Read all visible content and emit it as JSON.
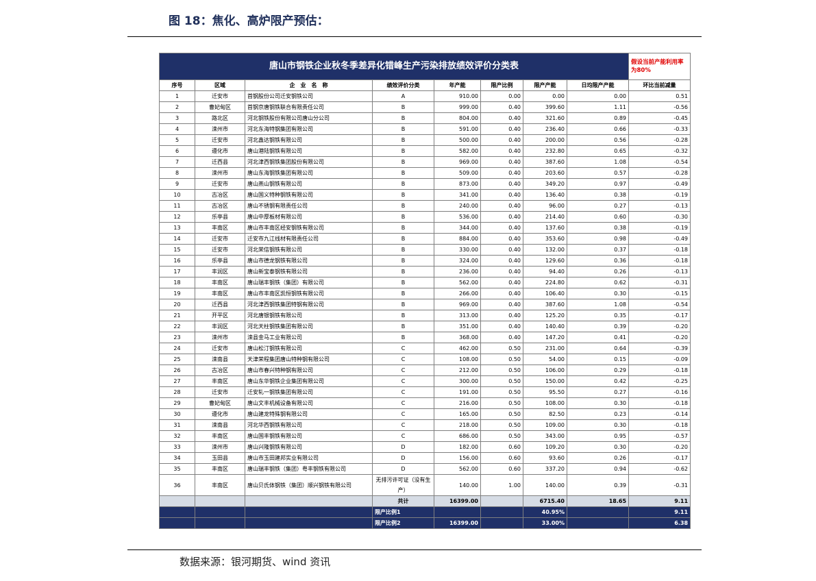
{
  "figure_title": "图 18：焦化、高炉限产预估：",
  "source": "数据来源：银河期货、wind 资讯",
  "table": {
    "title": "唐山市钢铁企业秋冬季差异化错峰生产污染排放绩效评价分类表",
    "note": "假设当前产能利用率为80%",
    "headers": [
      "序号",
      "区域",
      "企　业　名　称",
      "绩效评价分类",
      "年产能",
      "限产比例",
      "限产产能",
      "日均限产产能",
      "环比当前减量"
    ],
    "rows": [
      [
        "1",
        "迁安市",
        "首钢股份公司迁安钢铁公司",
        "A",
        "910.00",
        "0.00",
        "0.00",
        "0.00",
        "0.51"
      ],
      [
        "2",
        "曹妃甸区",
        "首钢京唐钢铁联合有限责任公司",
        "B",
        "999.00",
        "0.40",
        "399.60",
        "1.11",
        "-0.56"
      ],
      [
        "3",
        "路北区",
        "河北钢铁股份有限公司唐山分公司",
        "B",
        "804.00",
        "0.40",
        "321.60",
        "0.89",
        "-0.45"
      ],
      [
        "4",
        "滦州市",
        "河北东海特钢集团有限公司",
        "B",
        "591.00",
        "0.40",
        "236.40",
        "0.66",
        "-0.33"
      ],
      [
        "5",
        "迁安市",
        "河北鑫达钢铁有限公司",
        "B",
        "500.00",
        "0.40",
        "200.00",
        "0.56",
        "-0.28"
      ],
      [
        "6",
        "遵化市",
        "唐山港陆钢铁有限公司",
        "B",
        "582.00",
        "0.40",
        "232.80",
        "0.65",
        "-0.32"
      ],
      [
        "7",
        "迁西县",
        "河北津西钢铁集团股份有限公司",
        "B",
        "969.00",
        "0.40",
        "387.60",
        "1.08",
        "-0.54"
      ],
      [
        "8",
        "滦州市",
        "唐山东海钢铁集团有限公司",
        "B",
        "509.00",
        "0.40",
        "203.60",
        "0.57",
        "-0.28"
      ],
      [
        "9",
        "迁安市",
        "唐山燕山钢铁有限公司",
        "B",
        "873.00",
        "0.40",
        "349.20",
        "0.97",
        "-0.49"
      ],
      [
        "10",
        "古冶区",
        "唐山国义特种钢铁有限公司",
        "B",
        "341.00",
        "0.40",
        "136.40",
        "0.38",
        "-0.19"
      ],
      [
        "11",
        "古冶区",
        "唐山不锈钢有限责任公司",
        "B",
        "240.00",
        "0.40",
        "96.00",
        "0.27",
        "-0.13"
      ],
      [
        "12",
        "乐亭县",
        "唐山中厚板材有限公司",
        "B",
        "536.00",
        "0.40",
        "214.40",
        "0.60",
        "-0.30"
      ],
      [
        "13",
        "丰南区",
        "唐山市丰南区经安钢铁有限公司",
        "B",
        "344.00",
        "0.40",
        "137.60",
        "0.38",
        "-0.19"
      ],
      [
        "14",
        "迁安市",
        "迁安市九江线材有限责任公司",
        "B",
        "884.00",
        "0.40",
        "353.60",
        "0.98",
        "-0.49"
      ],
      [
        "15",
        "迁安市",
        "河北荣信钢铁有限公司",
        "B",
        "330.00",
        "0.40",
        "132.00",
        "0.37",
        "-0.18"
      ],
      [
        "16",
        "乐亭县",
        "唐山市德龙钢铁有限公司",
        "B",
        "324.00",
        "0.40",
        "129.60",
        "0.36",
        "-0.18"
      ],
      [
        "17",
        "丰润区",
        "唐山新宝泰钢铁有限公司",
        "B",
        "236.00",
        "0.40",
        "94.40",
        "0.26",
        "-0.13"
      ],
      [
        "18",
        "丰南区",
        "唐山瑞丰钢铁（集团）有限公司",
        "B",
        "562.00",
        "0.40",
        "224.80",
        "0.62",
        "-0.31"
      ],
      [
        "19",
        "丰南区",
        "唐山市丰南区凯恒钢铁有限公司",
        "B",
        "266.00",
        "0.40",
        "106.40",
        "0.30",
        "-0.15"
      ],
      [
        "20",
        "迁西县",
        "河北津西钢铁集团特钢有限公司",
        "B",
        "969.00",
        "0.40",
        "387.60",
        "1.08",
        "-0.54"
      ],
      [
        "21",
        "开平区",
        "河北唐银钢铁有限公司",
        "B",
        "313.00",
        "0.40",
        "125.20",
        "0.35",
        "-0.17"
      ],
      [
        "22",
        "丰润区",
        "河北天柱钢铁集团有限公司",
        "B",
        "351.00",
        "0.40",
        "140.40",
        "0.39",
        "-0.20"
      ],
      [
        "23",
        "滦州市",
        "滦县金马工业有限公司",
        "B",
        "368.00",
        "0.40",
        "147.20",
        "0.41",
        "-0.20"
      ],
      [
        "24",
        "迁安市",
        "唐山松汀钢铁有限公司",
        "C",
        "462.00",
        "0.50",
        "231.00",
        "0.64",
        "-0.39"
      ],
      [
        "25",
        "滦南县",
        "天津荣程集团唐山特种钢有限公司",
        "C",
        "108.00",
        "0.50",
        "54.00",
        "0.15",
        "-0.09"
      ],
      [
        "26",
        "古冶区",
        "唐山市春兴特种钢有限公司",
        "C",
        "212.00",
        "0.50",
        "106.00",
        "0.29",
        "-0.18"
      ],
      [
        "27",
        "丰南区",
        "唐山东华钢铁企业集团有限公司",
        "C",
        "300.00",
        "0.50",
        "150.00",
        "0.42",
        "-0.25"
      ],
      [
        "28",
        "迁安市",
        "迁安轧一钢铁集团有限公司",
        "C",
        "191.00",
        "0.50",
        "95.50",
        "0.27",
        "-0.16"
      ],
      [
        "29",
        "曹妃甸区",
        "唐山文丰机械设备有限公司",
        "C",
        "216.00",
        "0.50",
        "108.00",
        "0.30",
        "-0.18"
      ],
      [
        "30",
        "遵化市",
        "唐山建龙特殊钢有限公司",
        "C",
        "165.00",
        "0.50",
        "82.50",
        "0.23",
        "-0.14"
      ],
      [
        "31",
        "滦南县",
        "河北华西钢铁有限公司",
        "C",
        "218.00",
        "0.50",
        "109.00",
        "0.30",
        "-0.18"
      ],
      [
        "32",
        "丰南区",
        "唐山国丰钢铁有限公司",
        "C",
        "686.00",
        "0.50",
        "343.00",
        "0.95",
        "-0.57"
      ],
      [
        "33",
        "滦州市",
        "唐山兴隆钢铁有限公司",
        "D",
        "182.00",
        "0.60",
        "109.20",
        "0.30",
        "-0.20"
      ],
      [
        "34",
        "玉田县",
        "唐山市玉田建邦实业有限公司",
        "D",
        "156.00",
        "0.60",
        "93.60",
        "0.26",
        "-0.17"
      ],
      [
        "35",
        "丰南区",
        "唐山瑞丰钢铁（集团）粤丰钢铁有限公司",
        "D",
        "562.00",
        "0.60",
        "337.20",
        "0.94",
        "-0.62"
      ],
      [
        "36",
        "丰南区",
        "唐山贝氏体钢铁（集团）顺兴钢铁有限公司",
        "无排污许可证（没有生产）",
        "140.00",
        "1.00",
        "140.00",
        "0.39",
        "-0.31"
      ]
    ],
    "total": {
      "label": "共计",
      "annual": "16399.00",
      "limited": "6715.40",
      "daily": "18.65",
      "change": "9.11"
    },
    "ratio1": {
      "label": "限产比例1",
      "annual": "",
      "pct": "40.95%",
      "change": "9.11"
    },
    "ratio2": {
      "label": "限产比例2",
      "annual": "16399.00",
      "pct": "33.00%",
      "change": "6.38"
    }
  }
}
